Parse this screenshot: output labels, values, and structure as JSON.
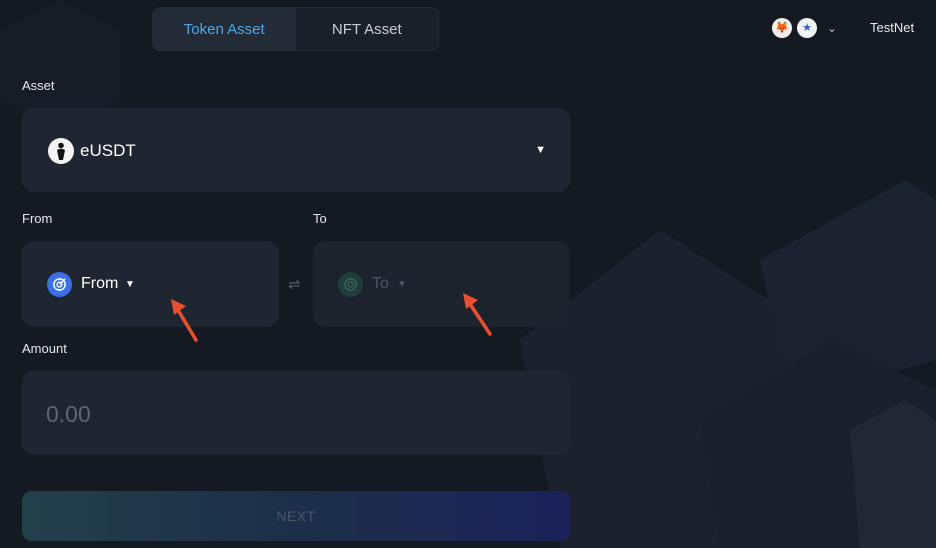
{
  "tabs": [
    {
      "label": "Token Asset",
      "active": true
    },
    {
      "label": "NFT Asset",
      "active": false
    }
  ],
  "wallet": {
    "icons": [
      "metamask-fox-icon",
      "network-star-icon"
    ],
    "network_label": "TestNet"
  },
  "asset": {
    "label": "Asset",
    "selected_token": "eUSDT",
    "token_icon": "person-silhouette-icon"
  },
  "from": {
    "label": "From",
    "placeholder": "From",
    "icon": "target-chain-icon"
  },
  "to": {
    "label": "To",
    "placeholder": "To",
    "icon": "target-chain-icon"
  },
  "swap_icon": "swap-arrows-icon",
  "amount": {
    "label": "Amount",
    "placeholder": "0.00"
  },
  "next_button": "NEXT",
  "colors": {
    "background": "#151a22",
    "card": "#202631",
    "accent": "#4ea8e8",
    "annotation_arrow": "#e8502f"
  }
}
